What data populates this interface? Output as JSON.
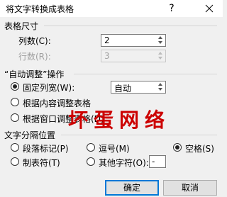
{
  "dialog": {
    "title": "将文字转换成表格",
    "help_glyph": "?",
    "close_icon": "close-icon"
  },
  "table_size": {
    "heading": "表格尺寸",
    "columns_label": "列数(C):",
    "columns_value": "2",
    "rows_label": "行数(R):",
    "rows_value": "3"
  },
  "autofit": {
    "heading": "“自动调整”操作",
    "fixed_label": "固定列宽(W):",
    "fixed_value": "自动",
    "content_label": "根据内容调整表格",
    "window_label": "根据窗口调整表格(D)",
    "selected": "fixed"
  },
  "separator": {
    "heading": "文字分隔位置",
    "paragraph_label": "段落标记(P)",
    "comma_label": "逗号(M)",
    "space_label": "空格(S)",
    "tab_label": "制表符(T)",
    "other_label": "其他字符(O):",
    "other_value": "-",
    "selected": "space"
  },
  "buttons": {
    "ok": "确定",
    "cancel": "取消"
  },
  "watermark": {
    "text": "坏蛋网络",
    "color": "#cc0000"
  }
}
